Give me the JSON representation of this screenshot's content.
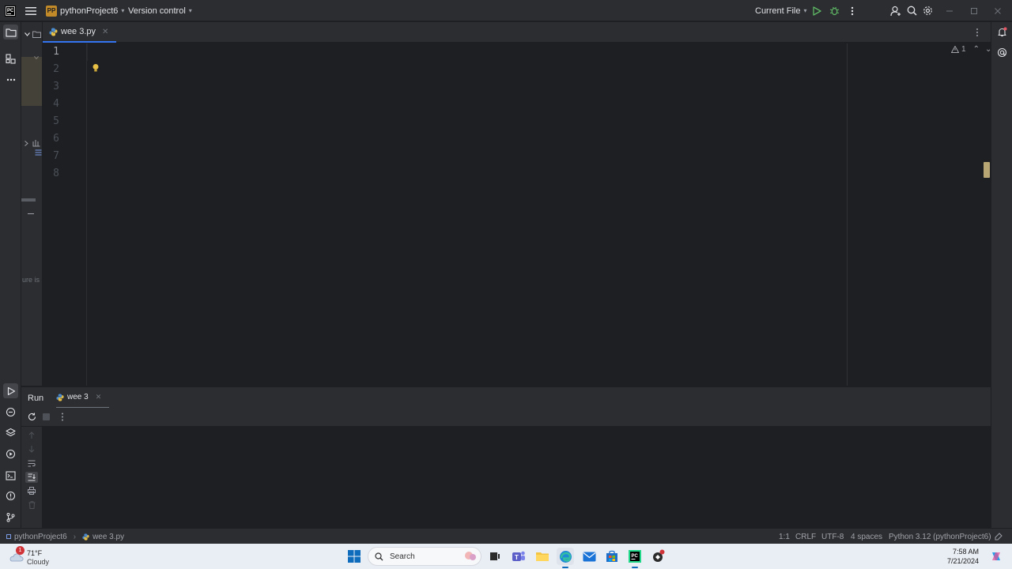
{
  "titlebar": {
    "project_badge": "PP",
    "project_name": "pythonProject6",
    "vcs_label": "Version control",
    "run_config": "Current File"
  },
  "editor": {
    "tab_label": "wee 3.py",
    "line_numbers": [
      "1",
      "2",
      "3",
      "4",
      "5",
      "6",
      "7",
      "8"
    ],
    "inspection_count": "1"
  },
  "project_panel": {
    "clipped_text": "ure is"
  },
  "run_panel": {
    "title": "Run",
    "tab_label": "wee 3"
  },
  "statusbar": {
    "breadcrumb_project": "pythonProject6",
    "breadcrumb_file": "wee 3.py",
    "position": "1:1",
    "line_ending": "CRLF",
    "encoding": "UTF-8",
    "indent": "4 spaces",
    "interpreter": "Python 3.12 (pythonProject6)"
  },
  "taskbar": {
    "weather_temp": "71°F",
    "weather_desc": "Cloudy",
    "weather_badge": "1",
    "search_placeholder": "Search",
    "time": "7:58 AM",
    "date": "7/21/2024"
  },
  "colors": {
    "accent": "#3574f0",
    "run_green": "#5fb865",
    "warning_yellow": "#e8c046",
    "notification_red": "#e55765"
  }
}
